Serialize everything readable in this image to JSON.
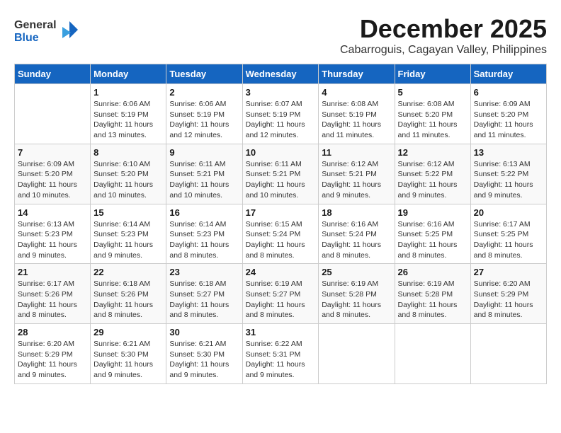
{
  "logo": {
    "general": "General",
    "blue": "Blue"
  },
  "title": "December 2025",
  "subtitle": "Cabarroguis, Cagayan Valley, Philippines",
  "weekdays": [
    "Sunday",
    "Monday",
    "Tuesday",
    "Wednesday",
    "Thursday",
    "Friday",
    "Saturday"
  ],
  "weeks": [
    [
      {
        "day": "",
        "info": ""
      },
      {
        "day": "1",
        "info": "Sunrise: 6:06 AM\nSunset: 5:19 PM\nDaylight: 11 hours\nand 13 minutes."
      },
      {
        "day": "2",
        "info": "Sunrise: 6:06 AM\nSunset: 5:19 PM\nDaylight: 11 hours\nand 12 minutes."
      },
      {
        "day": "3",
        "info": "Sunrise: 6:07 AM\nSunset: 5:19 PM\nDaylight: 11 hours\nand 12 minutes."
      },
      {
        "day": "4",
        "info": "Sunrise: 6:08 AM\nSunset: 5:19 PM\nDaylight: 11 hours\nand 11 minutes."
      },
      {
        "day": "5",
        "info": "Sunrise: 6:08 AM\nSunset: 5:20 PM\nDaylight: 11 hours\nand 11 minutes."
      },
      {
        "day": "6",
        "info": "Sunrise: 6:09 AM\nSunset: 5:20 PM\nDaylight: 11 hours\nand 11 minutes."
      }
    ],
    [
      {
        "day": "7",
        "info": "Sunrise: 6:09 AM\nSunset: 5:20 PM\nDaylight: 11 hours\nand 10 minutes."
      },
      {
        "day": "8",
        "info": "Sunrise: 6:10 AM\nSunset: 5:20 PM\nDaylight: 11 hours\nand 10 minutes."
      },
      {
        "day": "9",
        "info": "Sunrise: 6:11 AM\nSunset: 5:21 PM\nDaylight: 11 hours\nand 10 minutes."
      },
      {
        "day": "10",
        "info": "Sunrise: 6:11 AM\nSunset: 5:21 PM\nDaylight: 11 hours\nand 10 minutes."
      },
      {
        "day": "11",
        "info": "Sunrise: 6:12 AM\nSunset: 5:21 PM\nDaylight: 11 hours\nand 9 minutes."
      },
      {
        "day": "12",
        "info": "Sunrise: 6:12 AM\nSunset: 5:22 PM\nDaylight: 11 hours\nand 9 minutes."
      },
      {
        "day": "13",
        "info": "Sunrise: 6:13 AM\nSunset: 5:22 PM\nDaylight: 11 hours\nand 9 minutes."
      }
    ],
    [
      {
        "day": "14",
        "info": "Sunrise: 6:13 AM\nSunset: 5:23 PM\nDaylight: 11 hours\nand 9 minutes."
      },
      {
        "day": "15",
        "info": "Sunrise: 6:14 AM\nSunset: 5:23 PM\nDaylight: 11 hours\nand 9 minutes."
      },
      {
        "day": "16",
        "info": "Sunrise: 6:14 AM\nSunset: 5:23 PM\nDaylight: 11 hours\nand 8 minutes."
      },
      {
        "day": "17",
        "info": "Sunrise: 6:15 AM\nSunset: 5:24 PM\nDaylight: 11 hours\nand 8 minutes."
      },
      {
        "day": "18",
        "info": "Sunrise: 6:16 AM\nSunset: 5:24 PM\nDaylight: 11 hours\nand 8 minutes."
      },
      {
        "day": "19",
        "info": "Sunrise: 6:16 AM\nSunset: 5:25 PM\nDaylight: 11 hours\nand 8 minutes."
      },
      {
        "day": "20",
        "info": "Sunrise: 6:17 AM\nSunset: 5:25 PM\nDaylight: 11 hours\nand 8 minutes."
      }
    ],
    [
      {
        "day": "21",
        "info": "Sunrise: 6:17 AM\nSunset: 5:26 PM\nDaylight: 11 hours\nand 8 minutes."
      },
      {
        "day": "22",
        "info": "Sunrise: 6:18 AM\nSunset: 5:26 PM\nDaylight: 11 hours\nand 8 minutes."
      },
      {
        "day": "23",
        "info": "Sunrise: 6:18 AM\nSunset: 5:27 PM\nDaylight: 11 hours\nand 8 minutes."
      },
      {
        "day": "24",
        "info": "Sunrise: 6:19 AM\nSunset: 5:27 PM\nDaylight: 11 hours\nand 8 minutes."
      },
      {
        "day": "25",
        "info": "Sunrise: 6:19 AM\nSunset: 5:28 PM\nDaylight: 11 hours\nand 8 minutes."
      },
      {
        "day": "26",
        "info": "Sunrise: 6:19 AM\nSunset: 5:28 PM\nDaylight: 11 hours\nand 8 minutes."
      },
      {
        "day": "27",
        "info": "Sunrise: 6:20 AM\nSunset: 5:29 PM\nDaylight: 11 hours\nand 8 minutes."
      }
    ],
    [
      {
        "day": "28",
        "info": "Sunrise: 6:20 AM\nSunset: 5:29 PM\nDaylight: 11 hours\nand 9 minutes."
      },
      {
        "day": "29",
        "info": "Sunrise: 6:21 AM\nSunset: 5:30 PM\nDaylight: 11 hours\nand 9 minutes."
      },
      {
        "day": "30",
        "info": "Sunrise: 6:21 AM\nSunset: 5:30 PM\nDaylight: 11 hours\nand 9 minutes."
      },
      {
        "day": "31",
        "info": "Sunrise: 6:22 AM\nSunset: 5:31 PM\nDaylight: 11 hours\nand 9 minutes."
      },
      {
        "day": "",
        "info": ""
      },
      {
        "day": "",
        "info": ""
      },
      {
        "day": "",
        "info": ""
      }
    ]
  ]
}
